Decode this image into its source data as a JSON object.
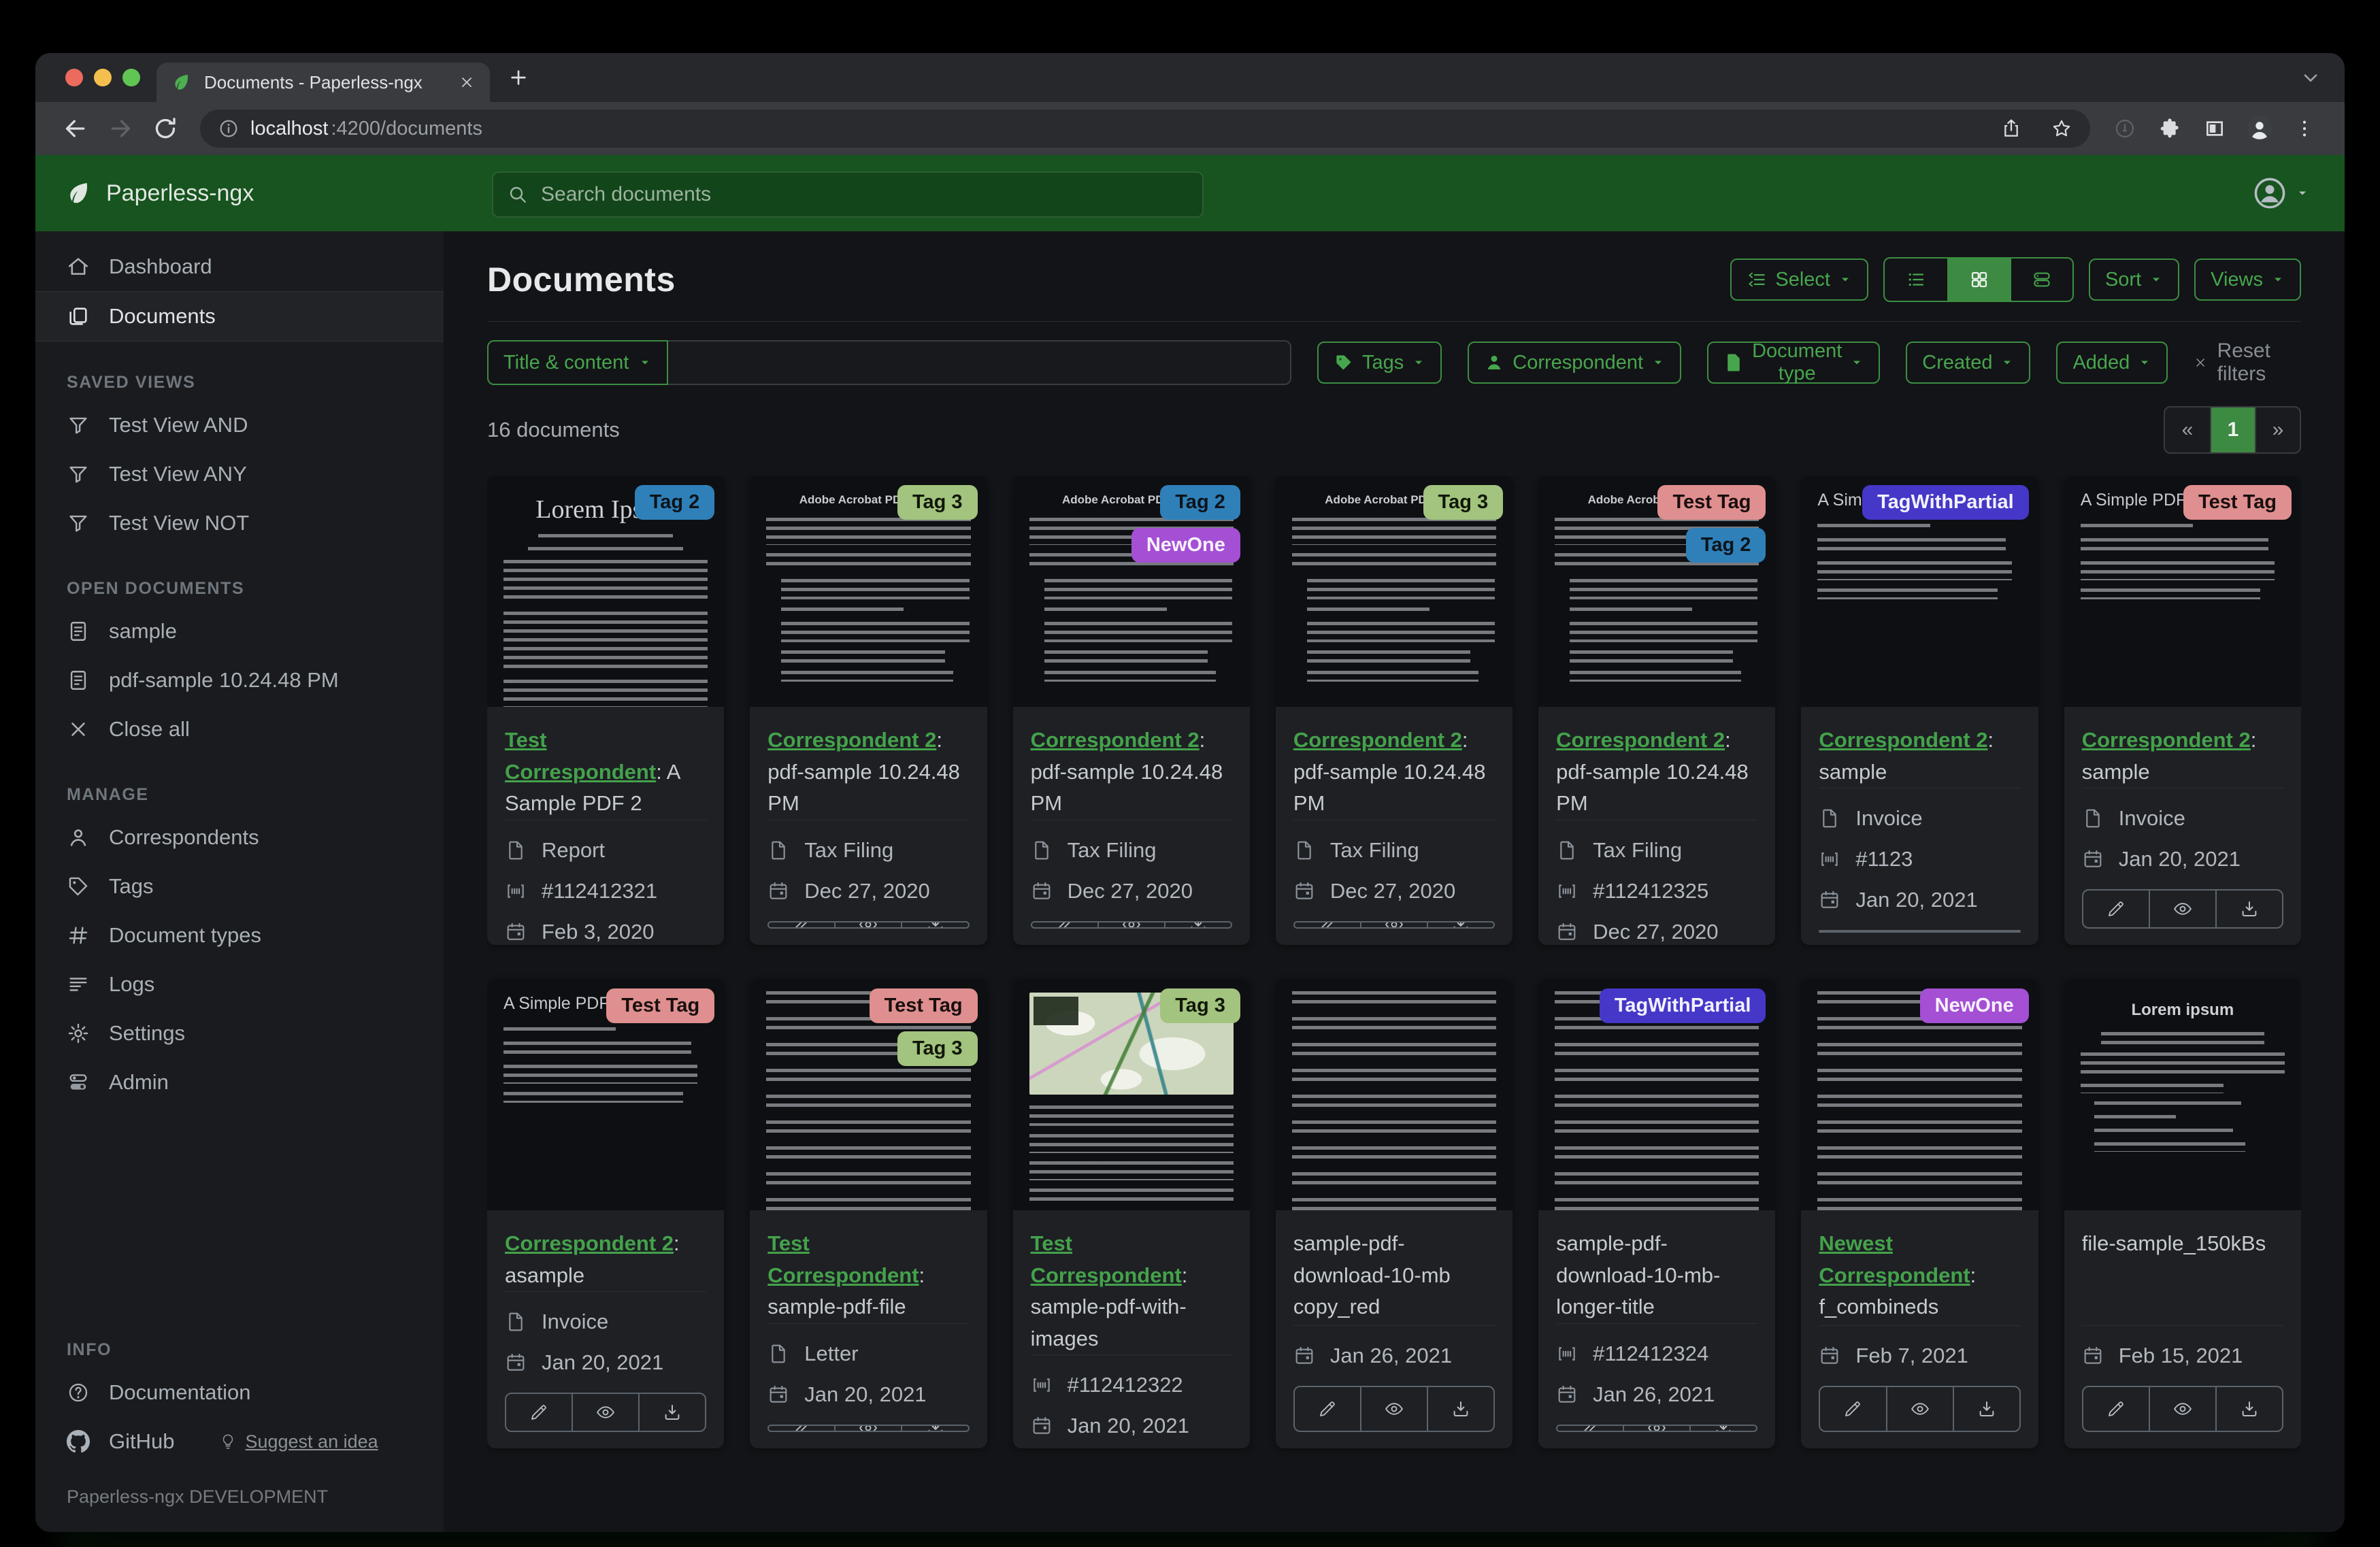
{
  "window": {
    "tab_title": "Documents - Paperless-ngx",
    "url_host": "localhost",
    "url_path": ":4200/documents"
  },
  "navbar": {
    "brand": "Paperless-ngx",
    "search_placeholder": "Search documents"
  },
  "sidebar": {
    "primary": [
      {
        "label": "Dashboard",
        "icon": "home"
      },
      {
        "label": "Documents",
        "icon": "copy",
        "active": true
      }
    ],
    "groups": [
      {
        "title": "SAVED VIEWS",
        "items": [
          {
            "label": "Test View AND",
            "icon": "funnel"
          },
          {
            "label": "Test View ANY",
            "icon": "funnel"
          },
          {
            "label": "Test View NOT",
            "icon": "funnel"
          }
        ]
      },
      {
        "title": "OPEN DOCUMENTS",
        "items": [
          {
            "label": "sample",
            "icon": "filetext"
          },
          {
            "label": "pdf-sample 10.24.48 PM",
            "icon": "filetext"
          },
          {
            "label": "Close all",
            "icon": "close"
          }
        ]
      },
      {
        "title": "MANAGE",
        "items": [
          {
            "label": "Correspondents",
            "icon": "person"
          },
          {
            "label": "Tags",
            "icon": "tag"
          },
          {
            "label": "Document types",
            "icon": "hash"
          },
          {
            "label": "Logs",
            "icon": "logs"
          },
          {
            "label": "Settings",
            "icon": "gear"
          },
          {
            "label": "Admin",
            "icon": "admin"
          }
        ]
      },
      {
        "title": "INFO",
        "items": [
          {
            "label": "Documentation",
            "icon": "question"
          },
          {
            "label": "GitHub",
            "icon": "github",
            "extra": {
              "label": "Suggest an idea",
              "icon": "bulb"
            }
          }
        ]
      }
    ],
    "footer": "Paperless-ngx DEVELOPMENT"
  },
  "header": {
    "title": "Documents",
    "select_label": "Select",
    "sort_label": "Sort",
    "views_label": "Views"
  },
  "filters": {
    "field_button": "Title & content",
    "search_value": "",
    "buttons": [
      {
        "label": "Tags",
        "icon": "tagfill"
      },
      {
        "label": "Correspondent",
        "icon": "personfill"
      },
      {
        "label": "Document type",
        "icon": "docfill"
      },
      {
        "label": "Created",
        "icon": null
      },
      {
        "label": "Added",
        "icon": null
      }
    ],
    "reset_label": "Reset filters"
  },
  "results": {
    "count_text": "16 documents"
  },
  "pagination": {
    "prev": "«",
    "current": "1",
    "next": "»"
  },
  "colors": {
    "navbar_green": "#17541f",
    "accent_green": "#3d8a42",
    "link_green": "#44a24b"
  },
  "tag_colors": {
    "Tag 2": {
      "bg": "#2f80b9",
      "fg": "#0c141b"
    },
    "Tag 3": {
      "bg": "#a2c47e",
      "fg": "#121708"
    },
    "Test Tag": {
      "bg": "#df8f8f",
      "fg": "#190e0e"
    },
    "TagWithPartial": {
      "bg": "#4537c8",
      "fg": "#f2f2fb"
    },
    "NewOne": {
      "bg": "#a44fd4",
      "fg": "#f8f2fc"
    }
  },
  "cards": [
    {
      "tags": [
        "Tag 2"
      ],
      "thumb": "lorem",
      "thumb_heading": "Lorem Ipsum",
      "correspondent": "Test Correspondent",
      "title": "A Sample PDF 2",
      "doc_type": "Report",
      "asn": "#112412321",
      "date": "Feb 3, 2020"
    },
    {
      "tags": [
        "Tag 3"
      ],
      "thumb": "acrobat",
      "thumb_heading": "Adobe Acrobat PDF Files",
      "correspondent": "Correspondent 2",
      "title": "pdf-sample 10.24.48 PM",
      "doc_type": "Tax Filing",
      "asn": null,
      "date": "Dec 27, 2020"
    },
    {
      "tags": [
        "Tag 2",
        "NewOne"
      ],
      "thumb": "acrobat",
      "thumb_heading": "Adobe Acrobat PDF Files",
      "correspondent": "Correspondent 2",
      "title": "pdf-sample 10.24.48 PM",
      "doc_type": "Tax Filing",
      "asn": null,
      "date": "Dec 27, 2020"
    },
    {
      "tags": [
        "Tag 3"
      ],
      "thumb": "acrobat",
      "thumb_heading": "Adobe Acrobat PDF Files",
      "correspondent": "Correspondent 2",
      "title": "pdf-sample 10.24.48 PM",
      "doc_type": "Tax Filing",
      "asn": null,
      "date": "Dec 27, 2020"
    },
    {
      "tags": [
        "Test Tag",
        "Tag 2"
      ],
      "thumb": "acrobat",
      "thumb_heading": "Adobe Acrobat PDF Files",
      "correspondent": "Correspondent 2",
      "title": "pdf-sample 10.24.48 PM",
      "doc_type": "Tax Filing",
      "asn": "#112412325",
      "date": "Dec 27, 2020"
    },
    {
      "tags": [
        "TagWithPartial"
      ],
      "thumb": "simple",
      "thumb_heading": "A Simple PDF File",
      "correspondent": "Correspondent 2",
      "title": "sample",
      "doc_type": "Invoice",
      "asn": "#1123",
      "date": "Jan 20, 2021"
    },
    {
      "tags": [
        "Test Tag"
      ],
      "thumb": "simple",
      "thumb_heading": "A Simple PDF File",
      "correspondent": "Correspondent 2",
      "title": "sample",
      "doc_type": "Invoice",
      "asn": null,
      "date": "Jan 20, 2021"
    },
    {
      "tags": [
        "Test Tag"
      ],
      "thumb": "simple",
      "thumb_heading": "A Simple PDF File",
      "correspondent": "Correspondent 2",
      "title": "asample",
      "doc_type": "Invoice",
      "asn": null,
      "date": "Jan 20, 2021"
    },
    {
      "tags": [
        "Test Tag",
        "Tag 3"
      ],
      "thumb": "dense",
      "thumb_heading": null,
      "correspondent": "Test Correspondent",
      "title": "sample-pdf-file",
      "doc_type": "Letter",
      "asn": null,
      "date": "Jan 20, 2021"
    },
    {
      "tags": [
        "Tag 3"
      ],
      "thumb": "map",
      "thumb_heading": null,
      "correspondent": "Test Correspondent",
      "title": "sample-pdf-with-images",
      "doc_type": null,
      "asn": "#112412322",
      "date": "Jan 20, 2021"
    },
    {
      "tags": [],
      "thumb": "dense",
      "thumb_heading": null,
      "correspondent": null,
      "title": "sample-pdf-download-10-mb copy_red",
      "doc_type": null,
      "asn": null,
      "date": "Jan 26, 2021"
    },
    {
      "tags": [
        "TagWithPartial"
      ],
      "thumb": "dense",
      "thumb_heading": null,
      "correspondent": null,
      "title": "sample-pdf-download-10-mb-longer-title",
      "doc_type": null,
      "asn": "#112412324",
      "date": "Jan 26, 2021"
    },
    {
      "tags": [
        "NewOne"
      ],
      "thumb": "dense",
      "thumb_heading": null,
      "correspondent": "Newest Correspondent",
      "title": "f_combineds",
      "doc_type": null,
      "asn": null,
      "date": "Feb 7, 2021"
    },
    {
      "tags": [],
      "thumb": "loremsample",
      "thumb_heading": "Lorem ipsum",
      "correspondent": null,
      "title": "file-sample_150kBs",
      "doc_type": null,
      "asn": null,
      "date": "Feb 15, 2021"
    }
  ]
}
